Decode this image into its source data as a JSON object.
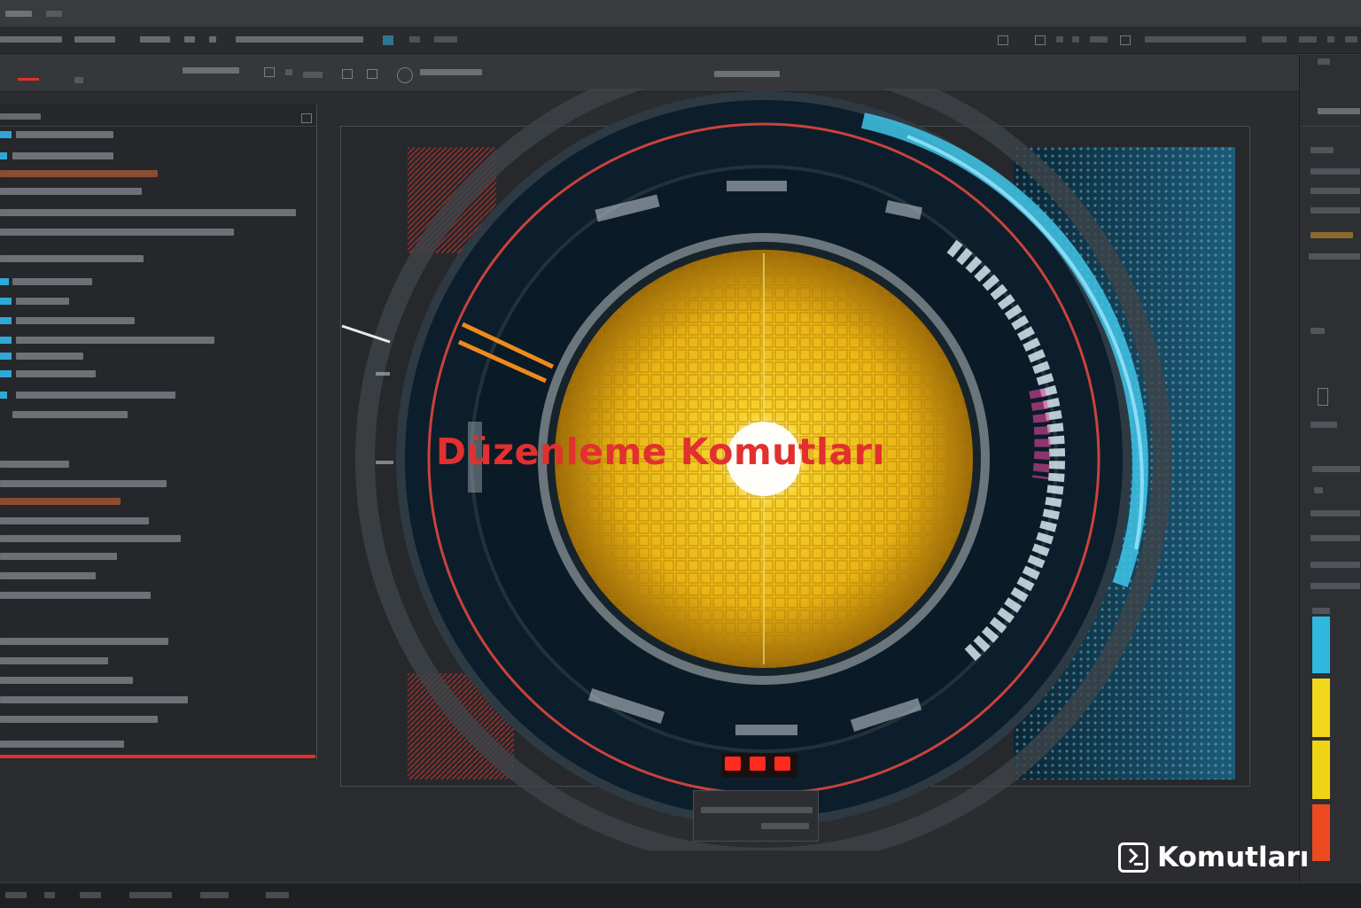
{
  "overlay": {
    "heading": "Düzenleme Komutları",
    "brand_text": "Komutları"
  },
  "icons": {
    "brand": "terminal-icon"
  },
  "colors": {
    "heading": "#e23030",
    "brand_text": "#ffffff",
    "accent_blue": "#2fa8d8",
    "accent_red": "#e0302a",
    "reactor_core": "#f2c21a",
    "ring_cyan": "#3fc6e8"
  },
  "swatches": [
    {
      "color": "#2fb9e0"
    },
    {
      "color": "#f2d81a"
    },
    {
      "color": "#f0d414"
    },
    {
      "color": "#ee4a22"
    }
  ]
}
